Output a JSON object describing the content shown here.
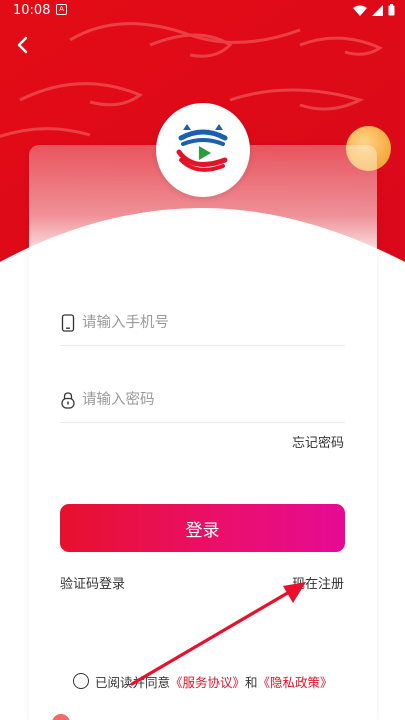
{
  "status_bar": {
    "time": "10:08",
    "app_icon": "A"
  },
  "header": {
    "back_icon": "chevron-left-icon"
  },
  "form": {
    "phone_placeholder": "请输入手机号",
    "password_placeholder": "请输入密码",
    "forgot_label": "忘记密码",
    "login_label": "登录",
    "sms_login_label": "验证码登录",
    "register_label": "现在注册"
  },
  "agreement": {
    "prefix": "已阅读并同意",
    "service_link": "《服务协议》",
    "joiner": "和",
    "privacy_link": "《隐私政策》"
  },
  "colors": {
    "brand_red": "#e8102c",
    "button_gradient_end": "#e60a94",
    "annotation_arrow": "#e8102c"
  }
}
